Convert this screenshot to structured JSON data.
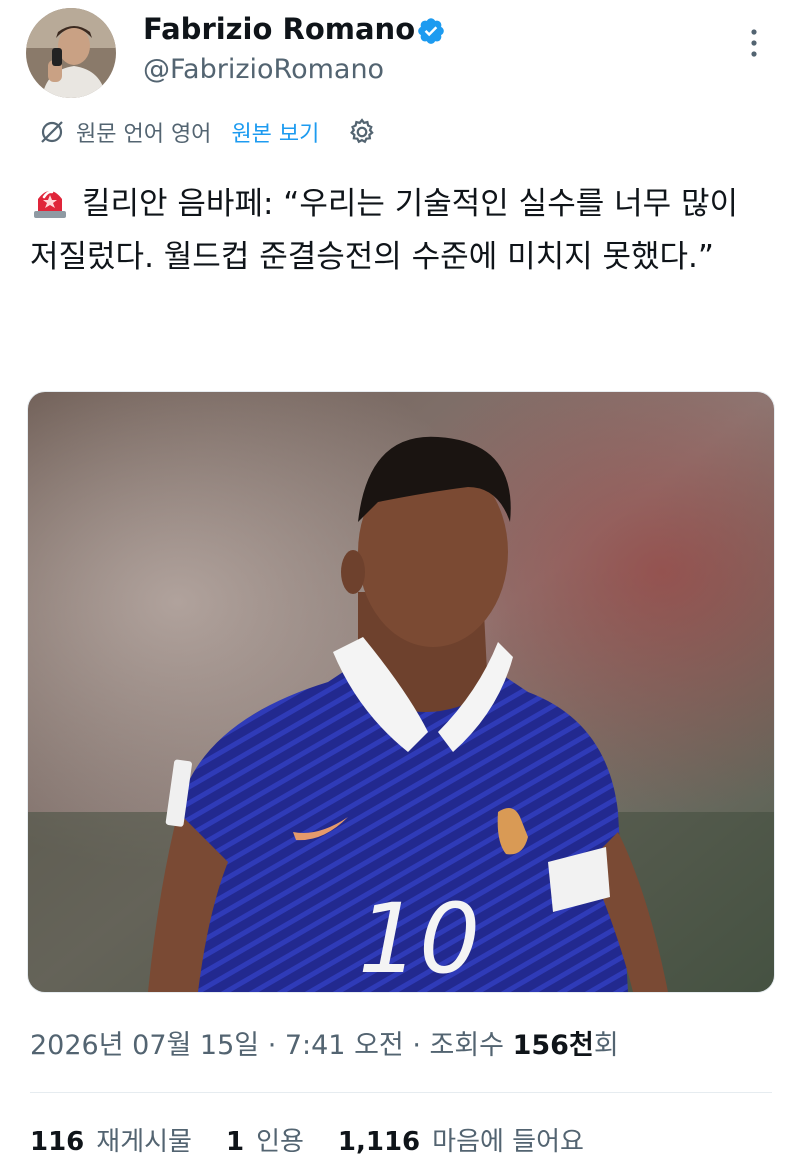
{
  "header": {
    "display_name": "Fabrizio Romano",
    "handle": "@FabrizioRomano"
  },
  "translation": {
    "label": "원문 언어 영어",
    "link": "원본 보기"
  },
  "tweet": {
    "text": "킬리안 음바페: “우리는 기술적인 실수를 너무 많이 저질렀다. 월드컵 준결승전의 수준에 미치지 못했다.”",
    "jersey_number": "10"
  },
  "meta": {
    "datetime": "2026년 07월 15일 · 7:41 오전 · 조회수 ",
    "views_count": "156천",
    "views_suffix": "회"
  },
  "stats": [
    {
      "count": "116",
      "label": "재게시물"
    },
    {
      "count": "1",
      "label": "인용"
    },
    {
      "count": "1,116",
      "label": "마음에 들어요"
    }
  ],
  "colors": {
    "accent": "#1d9bf0",
    "secondary_text": "#536471",
    "jersey": "#1f2a8a"
  }
}
